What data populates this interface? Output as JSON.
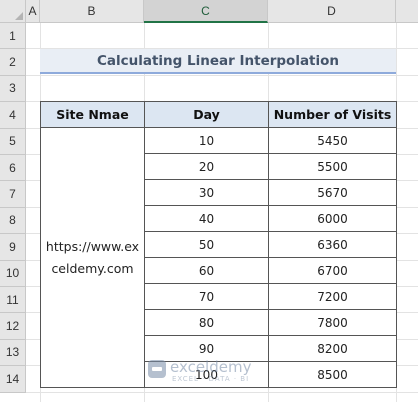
{
  "columns": [
    "A",
    "B",
    "C",
    "D"
  ],
  "selected_column": "C",
  "rows": [
    "1",
    "2",
    "3",
    "4",
    "5",
    "6",
    "7",
    "8",
    "9",
    "10",
    "11",
    "12",
    "13",
    "14"
  ],
  "title": "Calculating Linear Interpolation",
  "table": {
    "headers": [
      "Site Nmae",
      "Day",
      "Number of Visits"
    ],
    "site": "https://www.exceldemy.com",
    "data": [
      {
        "day": "10",
        "visits": "5450"
      },
      {
        "day": "20",
        "visits": "5500"
      },
      {
        "day": "30",
        "visits": "5670"
      },
      {
        "day": "40",
        "visits": "6000"
      },
      {
        "day": "50",
        "visits": "6360"
      },
      {
        "day": "60",
        "visits": "6700"
      },
      {
        "day": "70",
        "visits": "7200"
      },
      {
        "day": "80",
        "visits": "7800"
      },
      {
        "day": "90",
        "visits": "8200"
      },
      {
        "day": "100",
        "visits": "8500"
      }
    ]
  },
  "watermark": {
    "name": "exceldemy",
    "tagline": "EXCEL · DATA · BI"
  }
}
